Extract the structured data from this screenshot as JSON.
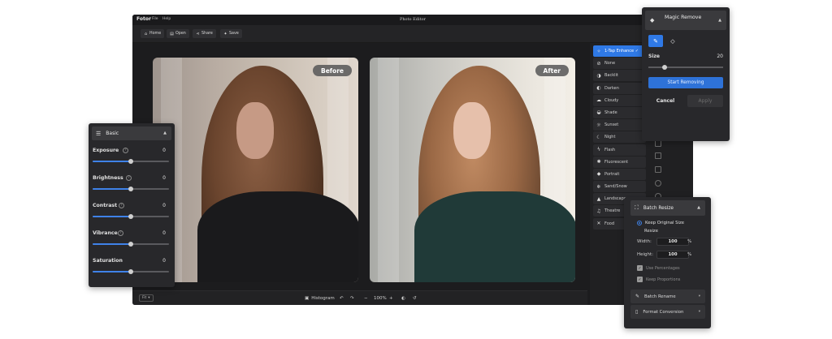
{
  "window": {
    "brand": "Fotor",
    "menu": [
      "File",
      "Help"
    ],
    "title": "Photo Editor"
  },
  "toolbar": {
    "home": "Home",
    "open": "Open",
    "share": "Share",
    "save": "Save"
  },
  "canvas": {
    "before_label": "Before",
    "after_label": "After"
  },
  "statusbar": {
    "fit": "Fit",
    "histogram": "Histogram",
    "zoom": "100%"
  },
  "filters": [
    {
      "label": "1-Tap Enhance ✓",
      "icon": "magic-wand-icon",
      "active": true
    },
    {
      "label": "None",
      "icon": "none-icon",
      "active": false
    },
    {
      "label": "Backlit",
      "icon": "backlit-icon",
      "active": false
    },
    {
      "label": "Darken",
      "icon": "darken-icon",
      "active": false
    },
    {
      "label": "Cloudy",
      "icon": "cloud-icon",
      "active": false
    },
    {
      "label": "Shade",
      "icon": "shade-icon",
      "active": false
    },
    {
      "label": "Sunset",
      "icon": "sunset-icon",
      "active": false
    },
    {
      "label": "Night",
      "icon": "moon-icon",
      "active": false
    },
    {
      "label": "Flash",
      "icon": "flash-icon",
      "active": false
    },
    {
      "label": "Fluorescent",
      "icon": "fluorescent-icon",
      "active": false
    },
    {
      "label": "Portrait",
      "icon": "portrait-icon",
      "active": false
    },
    {
      "label": "Sand/Snow",
      "icon": "snow-icon",
      "active": false
    },
    {
      "label": "Landscape",
      "icon": "landscape-icon",
      "active": false
    },
    {
      "label": "Theatre",
      "icon": "music-note-icon",
      "active": false
    },
    {
      "label": "Food",
      "icon": "food-icon",
      "active": false
    }
  ],
  "basic": {
    "title": "Basic",
    "adjustments": [
      {
        "label": "Exposure",
        "value": "0",
        "level": 0.5
      },
      {
        "label": "Brightness",
        "value": "0",
        "level": 0.5
      },
      {
        "label": "Contrast",
        "value": "0",
        "level": 0.5
      },
      {
        "label": "Vibrance",
        "value": "0",
        "level": 0.5
      },
      {
        "label": "Saturation",
        "value": "0",
        "level": 0.5
      }
    ]
  },
  "magic": {
    "title": "Magic Remove",
    "size_label": "Size",
    "size_value": "20",
    "size_level": 0.22,
    "start": "Start Removing",
    "cancel": "Cancel",
    "apply": "Apply"
  },
  "batch": {
    "title": "Batch Resize",
    "keep_original": "Keep Original Size",
    "resize": "Resize",
    "width_label": "Width:",
    "width_value": "100",
    "height_label": "Height:",
    "height_value": "100",
    "unit": "%",
    "use_percentages": "Use Percentages",
    "keep_proportions": "Keep Proportions",
    "batch_rename": "Batch Rename",
    "format_conversion": "Format Conversion"
  },
  "colors": {
    "accent": "#2f79e6",
    "panel": "#28282b",
    "window": "#1c1c1e"
  }
}
